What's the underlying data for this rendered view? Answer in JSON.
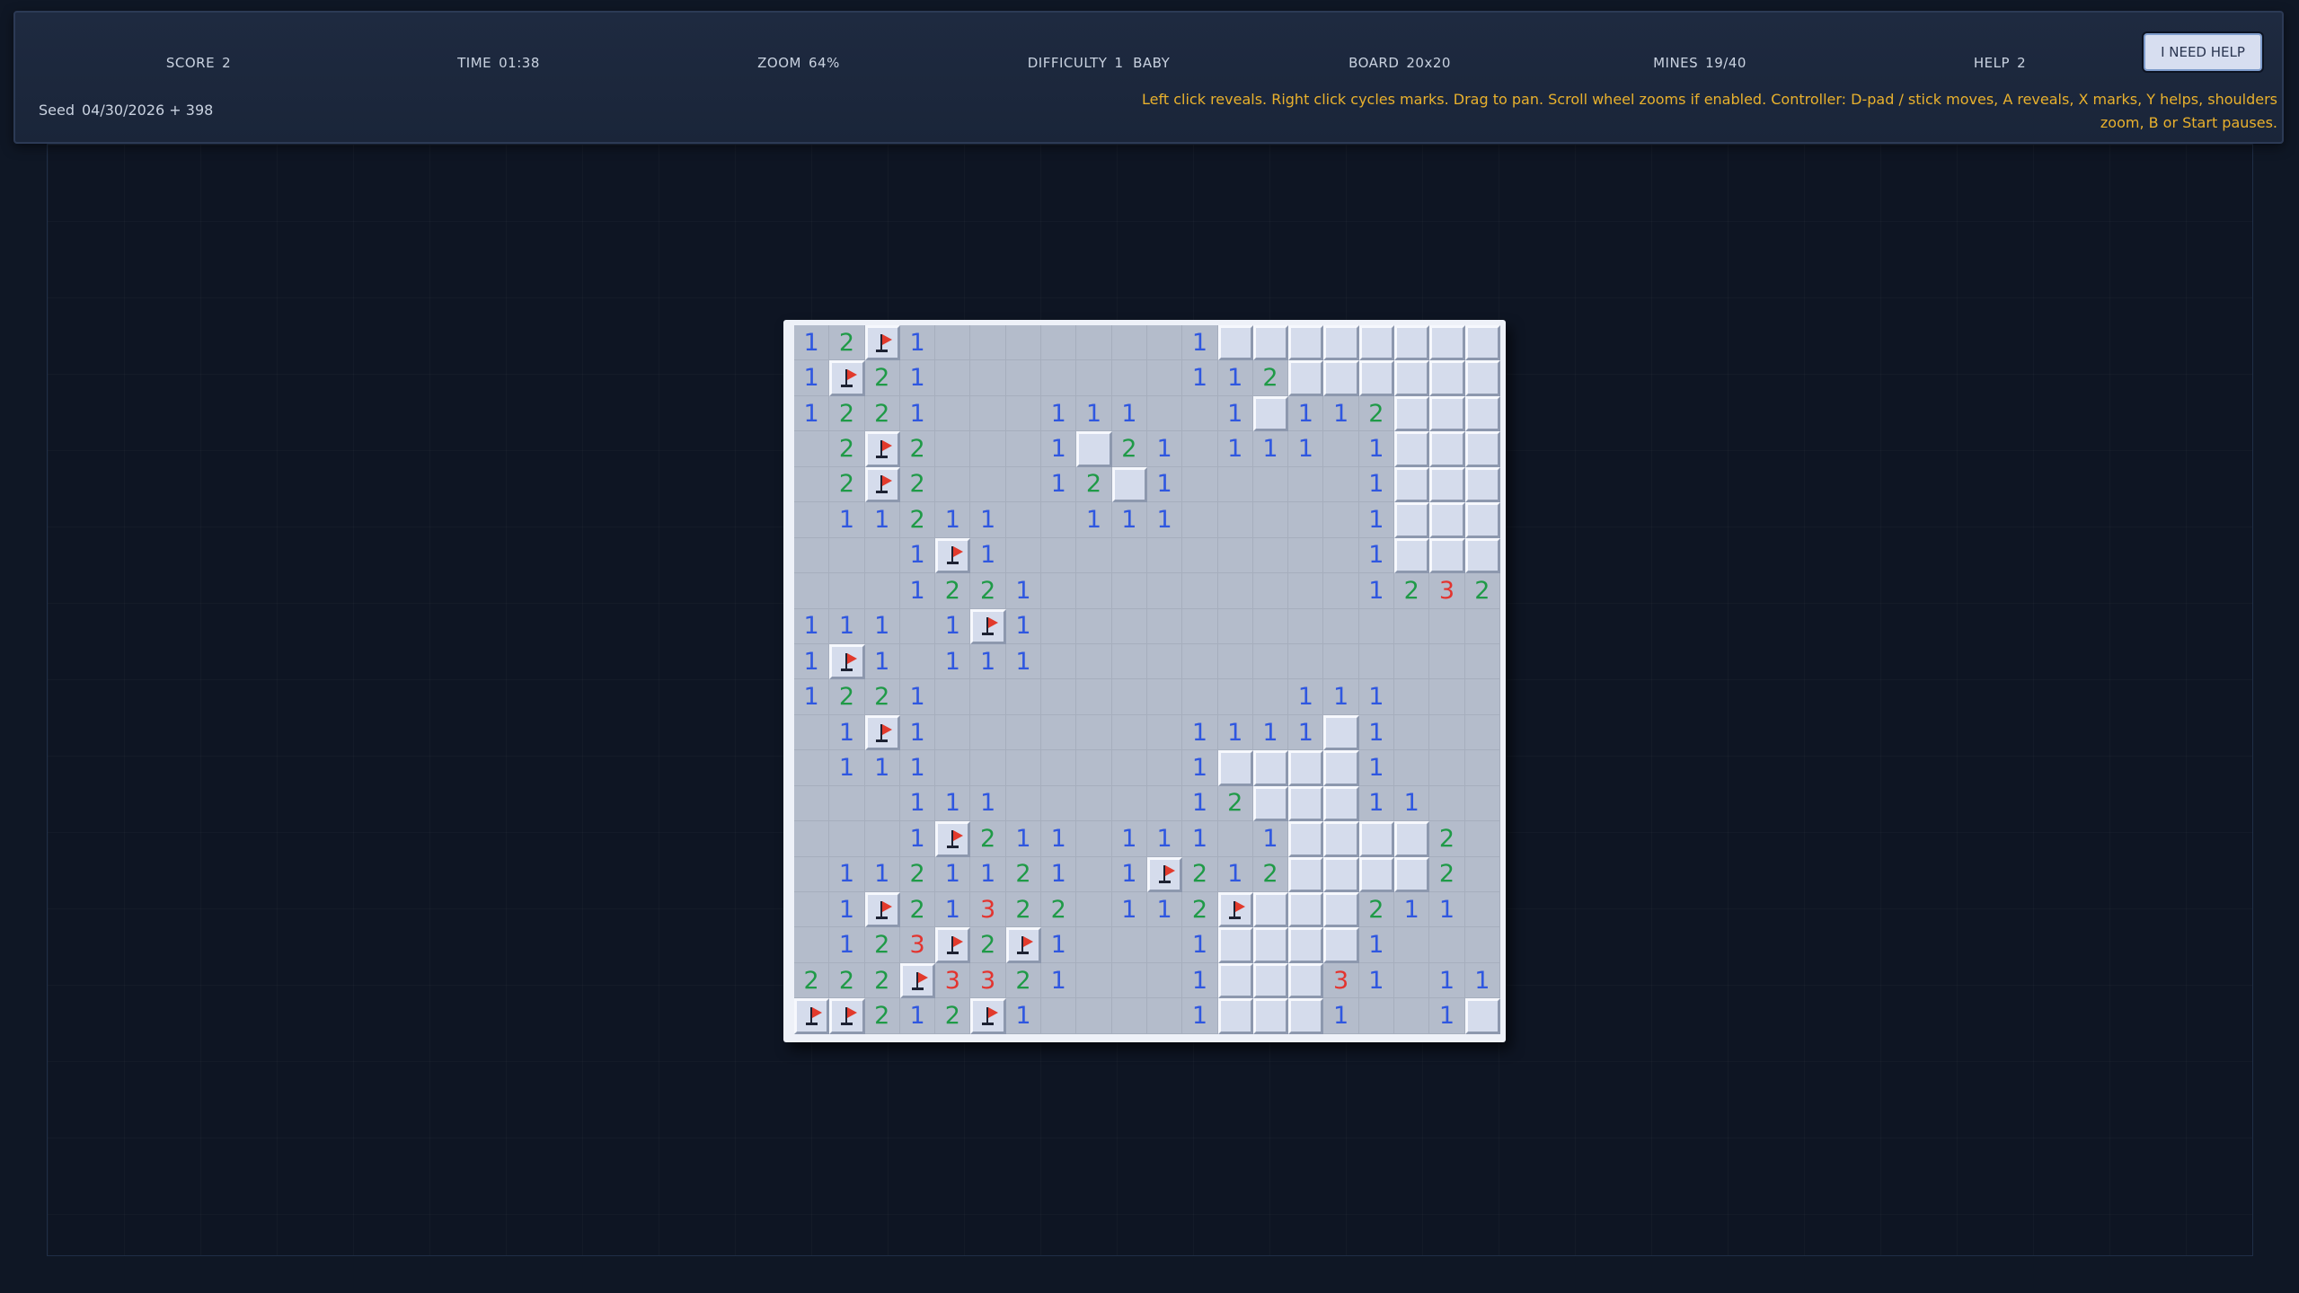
{
  "hud": {
    "stats": [
      {
        "label": "SCORE",
        "value": "2"
      },
      {
        "label": "TIME",
        "value": "01:38"
      },
      {
        "label": "ZOOM",
        "value": "64%"
      },
      {
        "label": "DIFFICULTY",
        "value": "1  BABY"
      },
      {
        "label": "BOARD",
        "value": "20x20"
      },
      {
        "label": "MINES",
        "value": "19/40"
      },
      {
        "label": "HELP",
        "value": "2"
      }
    ],
    "seed": {
      "label": "Seed",
      "value": "04/30/2026 + 398"
    },
    "help_button": "I NEED HELP",
    "instructions": "Left click reveals. Right click cycles marks. Drag to pan. Scroll wheel zooms if enabled. Controller: D-pad / stick moves, A reveals, X marks, Y helps, shoulders zoom, B or Start pauses."
  },
  "board": {
    "rows": 20,
    "cols": 20,
    "legend": {
      "#": "hidden",
      "F": "flag",
      ".": "revealed-empty",
      "1": "one",
      "2": "two",
      "3": "three"
    },
    "cells": [
      "12F1.......1########",
      "1F21.......112######",
      "1221...111..1#112###",
      ".2F2...1#21.111.1###",
      ".2F2...12#1.....1###",
      ".11211..111.....1###",
      "...1F1..........1###",
      "...1221.........1232",
      "111.1F1.............",
      "1F1.111.............",
      "1221..........111...",
      ".1F1.......1111#1...",
      ".111.......1####1...",
      "...111.....12###11..",
      "...1F211.111.1####2.",
      ".1121121.1F212####2.",
      ".1F21322.112F###211.",
      ".123F2F1...1####1...",
      "222F3321...1###31.11",
      "FF212F1....1###1..1#"
    ]
  }
}
